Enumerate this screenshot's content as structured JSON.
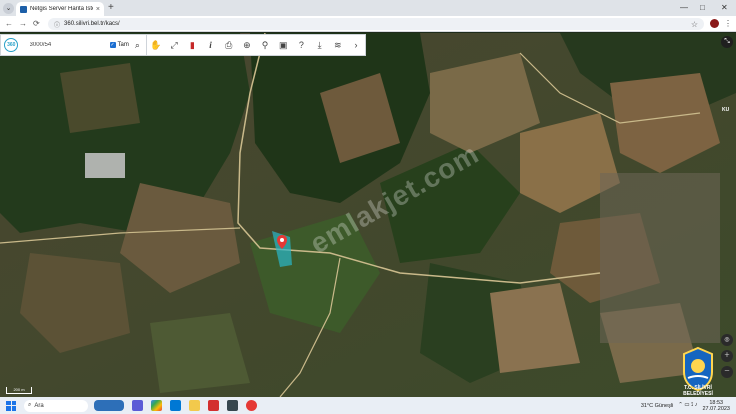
{
  "browser": {
    "tab_title": "Netgis Server Harita İstemcisi",
    "tab_close": "×",
    "new_tab": "+",
    "url": "360.silivri.bel.tr/kacs/",
    "lock_icon": "ⓘ",
    "star_icon": "☆",
    "back": "←",
    "forward": "→",
    "reload": "⟳",
    "menu": "⋮",
    "minimize": "—",
    "maximize": "□",
    "close": "✕",
    "tab_dropdown": "⌄"
  },
  "toolbar": {
    "logo_text": "360",
    "search_value": "3000/54",
    "tam_label": "Tam",
    "check": "✓",
    "search_icon": "⌕",
    "tools": [
      {
        "name": "pan-tool-icon",
        "glyph": "✋"
      },
      {
        "name": "full-extent-icon",
        "glyph": "⤢"
      },
      {
        "name": "delete-icon",
        "glyph": "▮"
      },
      {
        "name": "info-icon",
        "glyph": "i"
      },
      {
        "name": "print-icon",
        "glyph": "⎙"
      },
      {
        "name": "measure-icon",
        "glyph": "⊕"
      },
      {
        "name": "location-icon",
        "glyph": "⚲"
      },
      {
        "name": "image-icon",
        "glyph": "▣"
      },
      {
        "name": "help-icon",
        "glyph": "?"
      },
      {
        "name": "download-icon",
        "glyph": "⤓"
      },
      {
        "name": "layers-icon",
        "glyph": "≋"
      },
      {
        "name": "next-icon",
        "glyph": "›"
      }
    ]
  },
  "map": {
    "watermark": "emlakjet.com",
    "scale_label": "200 m",
    "place_label": "KU",
    "crest_text": "T.C. SİLİVRİ BELEDİYESİ",
    "expand_icon": "⤡",
    "side_controls": [
      "◎",
      "＋",
      "－"
    ]
  },
  "taskbar": {
    "search_placeholder": "Ara",
    "search_icon": "⌕",
    "weather": "31°C  Güneşli",
    "time": "18:53",
    "date": "27.07.2023",
    "tray_icons": "⌃  ▭  ⟟  ♪"
  },
  "colors": {
    "accent": "#27a0c8",
    "marker": "#e53935"
  }
}
